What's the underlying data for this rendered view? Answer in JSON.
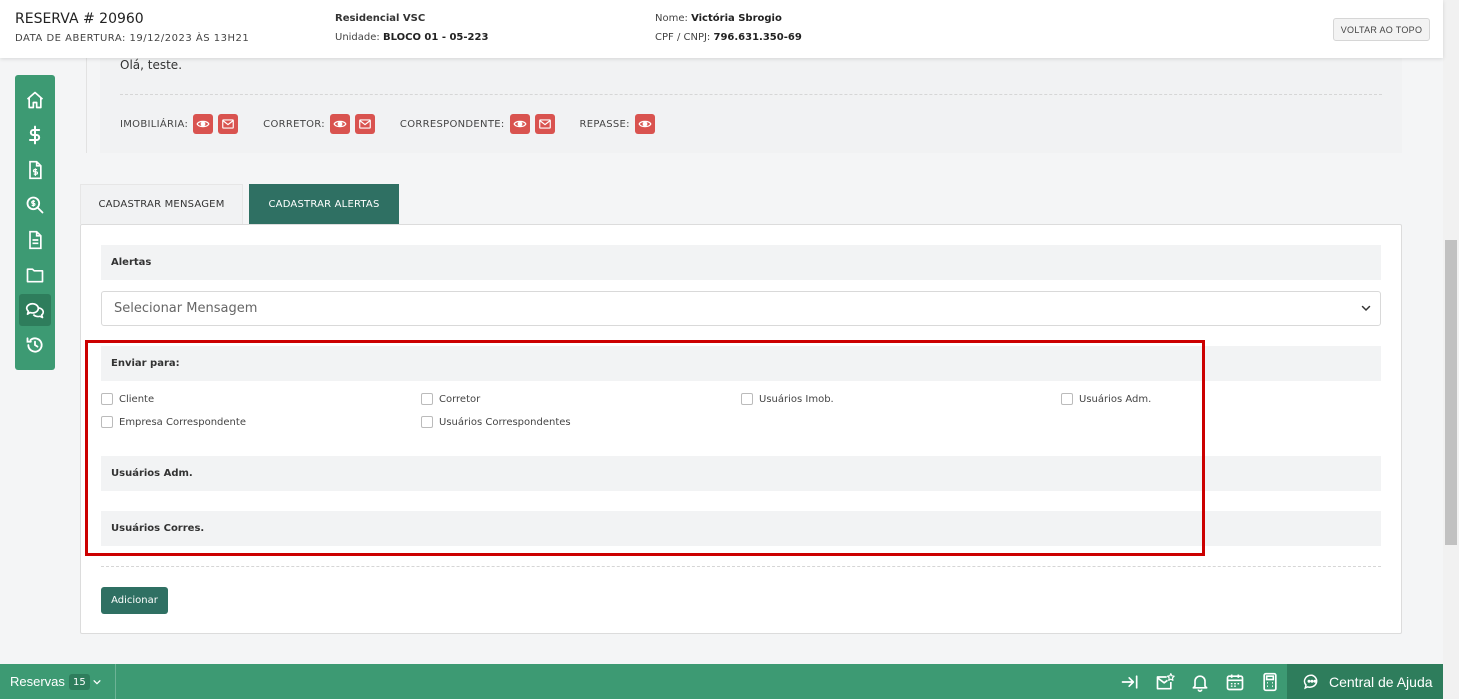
{
  "header": {
    "title": "RESERVA # 20960",
    "opening_date": "DATA DE ABERTURA: 19/12/2023 ÀS 13H21",
    "project": "Residencial VSC",
    "unit_label": "Unidade:",
    "unit_value": "BLOCO 01 - 05-223",
    "name_label": "Nome:",
    "name_value": "Victória Sbrogio",
    "doc_label": "CPF / CNPJ:",
    "doc_value": "796.631.350-69",
    "back_top_button": "VOLTAR AO TOPO"
  },
  "sidebar": {
    "items": [
      {
        "icon": "home-icon"
      },
      {
        "icon": "dollar-icon"
      },
      {
        "icon": "invoice-icon"
      },
      {
        "icon": "search-money-icon"
      },
      {
        "icon": "document-icon"
      },
      {
        "icon": "folder-icon"
      },
      {
        "icon": "chat-icon",
        "active": true
      },
      {
        "icon": "history-icon"
      }
    ]
  },
  "message": {
    "text": "Olá, teste.",
    "recipients": {
      "imobiliaria": "IMOBILIÁRIA:",
      "corretor": "CORRETOR:",
      "correspondente": "CORRESPONDENTE:",
      "repasse": "REPASSE:"
    }
  },
  "tabs": {
    "register_message": "CADASTRAR MENSAGEM",
    "register_alerts": "CADASTRAR ALERTAS"
  },
  "form": {
    "alerts_title": "Alertas",
    "select_placeholder": "Selecionar Mensagem",
    "send_to_title": "Enviar para:",
    "options": {
      "cliente": "Cliente",
      "corretor": "Corretor",
      "usuarios_imob": "Usuários Imob.",
      "usuarios_adm": "Usuários Adm.",
      "empresa_correspondente": "Empresa Correspondente",
      "usuarios_correspondentes": "Usuários Correspondentes"
    },
    "adm_users_title": "Usuários Adm.",
    "corres_users_title": "Usuários Corres.",
    "add_button": "Adicionar"
  },
  "bottom_bar": {
    "reservations_label": "Reservas",
    "reservations_count": "15",
    "help_label": "Central de Ajuda"
  },
  "colors": {
    "brand_green": "#3d9a73",
    "dark_green": "#2f7063",
    "danger_red": "#d9534f",
    "highlight_red": "#cc0000"
  }
}
